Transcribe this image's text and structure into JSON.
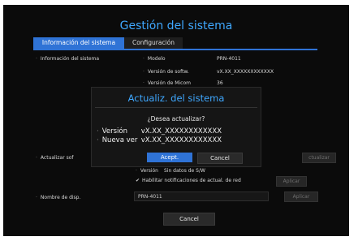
{
  "title": "Gestión del sistema",
  "tabs": [
    {
      "label": "Información del sistema"
    },
    {
      "label": "Configuración"
    }
  ],
  "info": {
    "section_label": "Información del sistema",
    "rows": [
      {
        "label": "Modelo",
        "value": "PRN-4011"
      },
      {
        "label": "Versión de softw.",
        "value": "vX.XX_XXXXXXXXXXXX"
      },
      {
        "label": "Versión de Micom",
        "value": "36"
      }
    ]
  },
  "update": {
    "section_label": "Actualizar sof",
    "right_button": "ctualizar",
    "version_label": "Versión",
    "version_value": "Sin datos de S/W",
    "notify_label": "Habilitar notificaciones de actual. de red",
    "apply_label": "Aplicar"
  },
  "device": {
    "label": "Nombre de disp.",
    "value": "PRN-4011",
    "apply_label": "Aplicar"
  },
  "dialog": {
    "title": "Actualiz. del sistema",
    "question": "¿Desea actualizar?",
    "version_label": "Versión",
    "version_value": "vX.XX_XXXXXXXXXXXX",
    "new_version_label": "Nueva ver",
    "new_version_value": "vX.XX_XXXXXXXXXXXX",
    "accept_label": "Acept.",
    "cancel_label": "Cancel"
  },
  "footer": {
    "cancel_label": "Cancel"
  },
  "colors": {
    "accent": "#3fa8ff",
    "tab_active": "#2f73d6",
    "background": "#0b0b0b"
  }
}
